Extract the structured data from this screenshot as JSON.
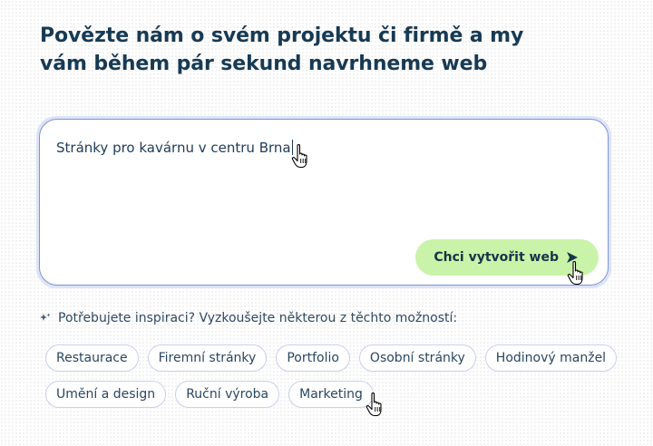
{
  "header": {
    "title_line1": "Povězte nám o svém projektu či firmě a my",
    "title_line2": "vám během pár sekund navrhneme web"
  },
  "prompt": {
    "value": "Stránky pro kavárnu v centru Brna",
    "submit_label": "Chci vytvořit web"
  },
  "inspiration": {
    "label": "Potřebujete inspiraci? Vyzkoušejte některou z těchto možností:",
    "chips_row1": [
      "Restaurace",
      "Firemní stránky",
      "Portfolio",
      "Osobní stránky",
      "Hodinový manžel"
    ],
    "chips_row2": [
      "Umění a design",
      "Ruční výroba",
      "Marketing"
    ]
  },
  "colors": {
    "heading": "#173a54",
    "submit_bg": "#c9f3a8",
    "input_border": "#7f93d6",
    "chip_border": "#c9cfec"
  },
  "icons": [
    "send-arrow-icon",
    "sparkle-icon",
    "hand-pointer-cursor-icon"
  ]
}
